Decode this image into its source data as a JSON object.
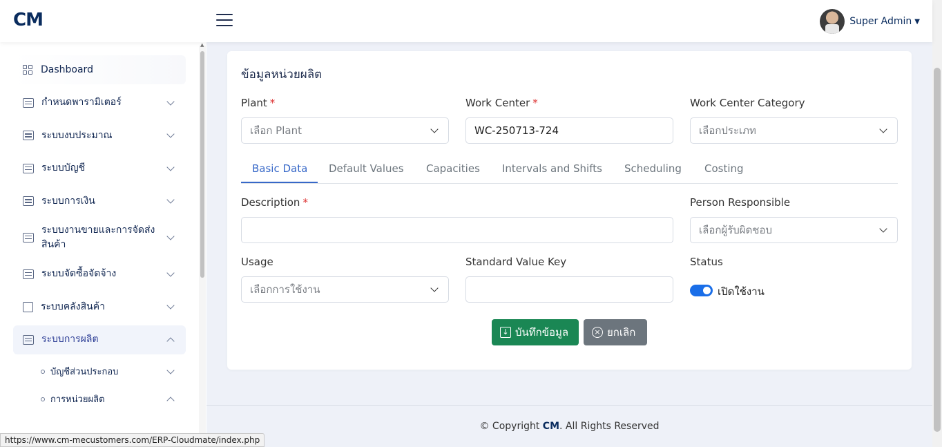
{
  "header": {
    "logo": "CM",
    "user_name": "Super Admin"
  },
  "sidebar": {
    "items": [
      {
        "label": "Dashboard",
        "icon": "grid-icon"
      },
      {
        "label": "กำหนดพารามิเตอร์",
        "icon": "server-icon"
      },
      {
        "label": "ระบบงบประมาณ",
        "icon": "server-icon"
      },
      {
        "label": "ระบบบัญชี",
        "icon": "server-icon"
      },
      {
        "label": "ระบบการเงิน",
        "icon": "server-icon"
      },
      {
        "label": "ระบบงานขายและการจัดส่งสินค้า",
        "icon": "server-icon"
      },
      {
        "label": "ระบบจัดซื้อจัดจ้าง",
        "icon": "server-icon"
      },
      {
        "label": "ระบบคลังสินค้า",
        "icon": "box-icon"
      },
      {
        "label": "ระบบการผลิต",
        "icon": "server-icon"
      }
    ],
    "sub_items": [
      {
        "label": "บัญชีส่วนประกอบ"
      },
      {
        "label": "การหน่วยผลิต"
      }
    ]
  },
  "form": {
    "title": "ข้อมูลหน่วยผลิต",
    "plant_label": "Plant",
    "plant_placeholder": "เลือก Plant",
    "work_center_label": "Work Center",
    "work_center_value": "WC-250713-724",
    "category_label": "Work Center Category",
    "category_placeholder": "เลือกประเภท",
    "required_mark": "*",
    "tabs": [
      {
        "label": "Basic Data"
      },
      {
        "label": "Default Values"
      },
      {
        "label": "Capacities"
      },
      {
        "label": "Intervals and Shifts"
      },
      {
        "label": "Scheduling"
      },
      {
        "label": "Costing"
      }
    ],
    "description_label": "Description",
    "description_value": "",
    "person_label": "Person Responsible",
    "person_placeholder": "เลือกผู้รับผิดชอบ",
    "usage_label": "Usage",
    "usage_placeholder": "เลือกการใช้งาน",
    "svk_label": "Standard Value Key",
    "svk_value": "",
    "status_label": "Status",
    "status_text": "เปิดใช้งาน",
    "status_on": true,
    "save_label": "บันทึกข้อมูล",
    "cancel_label": "ยกเลิก"
  },
  "footer": {
    "prefix": "© Copyright ",
    "brand": "CM",
    "suffix": ". All Rights Reserved"
  },
  "status_url": "https://www.cm-mecustomers.com/ERP-Cloudmate/index.php",
  "colors": {
    "brand": "#0a2c5e",
    "accent": "#3768c8",
    "save": "#1a8754",
    "cancel": "#6c757d",
    "toggle": "#1a6ee8"
  }
}
